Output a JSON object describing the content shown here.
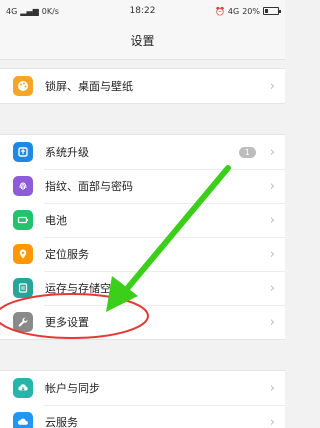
{
  "status_bar": {
    "network_left": "4G",
    "speed": "0K/s",
    "time": "18:22",
    "network_right": "4G",
    "battery_text": "20%"
  },
  "header": {
    "title": "设置"
  },
  "groups": [
    {
      "items": [
        {
          "label": "锁屏、桌面与壁纸",
          "icon": "palette-icon",
          "color": "#f5a623"
        }
      ]
    },
    {
      "items": [
        {
          "label": "系统升级",
          "icon": "system-update-icon",
          "color": "#1e88e5",
          "badge": "1"
        },
        {
          "label": "指纹、面部与密码",
          "icon": "fingerprint-icon",
          "color": "#8e5cd9"
        },
        {
          "label": "电池",
          "icon": "battery-icon",
          "color": "#22c36c"
        },
        {
          "label": "定位服务",
          "icon": "location-icon",
          "color": "#ff9800"
        },
        {
          "label": "运存与存储空间",
          "icon": "storage-icon",
          "color": "#26a69a"
        },
        {
          "label": "更多设置",
          "icon": "wrench-icon",
          "color": "#8a8a8a"
        }
      ]
    },
    {
      "items": [
        {
          "label": "帐户与同步",
          "icon": "account-sync-icon",
          "color": "#26b5a8"
        },
        {
          "label": "云服务",
          "icon": "cloud-icon",
          "color": "#2196f3"
        }
      ]
    }
  ],
  "annotation": {
    "arrow_color": "#3ccf1a",
    "circle_color": "#e53935"
  }
}
